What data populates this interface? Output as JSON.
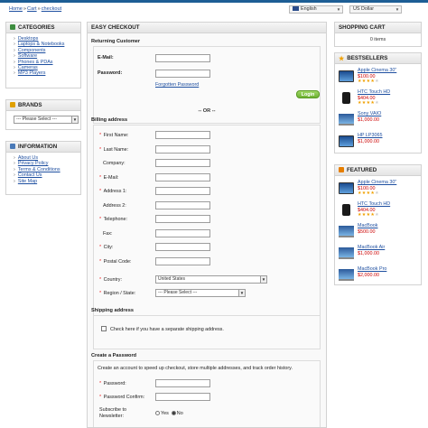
{
  "breadcrumb": {
    "items": [
      "Home",
      "Cart",
      "checkout"
    ]
  },
  "header": {
    "language": "English",
    "currency": "US Dollar"
  },
  "sidebar_left": {
    "categories": {
      "title": "CATEGORIES",
      "items": [
        "Desktops",
        "Laptops & Notebooks",
        "Components",
        "Software",
        "Phones & PDAs",
        "Cameras",
        "MP3 Players"
      ]
    },
    "brands": {
      "title": "BRANDS",
      "select": "--- Please Select ---"
    },
    "information": {
      "title": "INFORMATION",
      "items": [
        "About Us",
        "Privacy Policy",
        "Terms & Conditions",
        "Contact Us",
        "Site Map"
      ]
    }
  },
  "checkout": {
    "title": "EASY CHECKOUT",
    "returning": {
      "title": "Returning Customer",
      "email_label": "E-Mail:",
      "password_label": "Password:",
      "forgotten": "Forgotten Password",
      "login": "Login"
    },
    "or": "-- OR --",
    "billing": {
      "title": "Billing address",
      "fields": [
        {
          "label": "First Name:",
          "req": true
        },
        {
          "label": "Last Name:",
          "req": true
        },
        {
          "label": "Company:",
          "req": false
        },
        {
          "label": "E-Mail:",
          "req": true
        },
        {
          "label": "Address 1:",
          "req": true
        },
        {
          "label": "Address 2:",
          "req": false
        },
        {
          "label": "Telephone:",
          "req": true
        },
        {
          "label": "Fax:",
          "req": false
        },
        {
          "label": "City:",
          "req": true
        },
        {
          "label": "Postal Code:",
          "req": true
        }
      ],
      "country_label": "Country:",
      "country_value": "United States",
      "region_label": "Region / State:",
      "region_value": "--- Please Select ---"
    },
    "shipping": {
      "title": "Shipping address",
      "checkbox_label": "Check here if you have a separate shipping address."
    },
    "create_password": {
      "title": "Create a Password",
      "intro": "Create an account to speed up checkout, store multiple addresses, and track order history.",
      "password_label": "Password:",
      "confirm_label": "Password Confirm:",
      "subscribe_label_1": "Subscribe to",
      "subscribe_label_2": "Newsletter:",
      "yes": "Yes",
      "no": "No",
      "subscribe_selected": "No"
    }
  },
  "sidebar_right": {
    "cart": {
      "title": "SHOPPING CART",
      "count": "0 items"
    },
    "bestsellers": {
      "title": "BESTSELLERS",
      "items": [
        {
          "name": "Apple Cinema 30\"",
          "price": "$100.00",
          "rating": 4,
          "thumb": "monitor"
        },
        {
          "name": "HTC Touch HD",
          "price": "$404.00",
          "rating": 4,
          "thumb": "phone"
        },
        {
          "name": "Sony VAIO",
          "price": "$1,000.00",
          "rating": 0,
          "thumb": "laptop"
        },
        {
          "name": "HP LP3065",
          "price": "$1,000.00",
          "rating": 0,
          "thumb": "monitor"
        }
      ]
    },
    "featured": {
      "title": "FEATURED",
      "items": [
        {
          "name": "Apple Cinema 30\"",
          "price": "$100.00",
          "rating": 4,
          "thumb": "monitor"
        },
        {
          "name": "HTC Touch HD",
          "price": "$404.00",
          "rating": 4,
          "thumb": "phone"
        },
        {
          "name": "MacBook",
          "price": "$500.00",
          "rating": 0,
          "thumb": "laptop"
        },
        {
          "name": "MacBook Air",
          "price": "$1,000.00",
          "rating": 0,
          "thumb": "laptop"
        },
        {
          "name": "MacBook Pro",
          "price": "$2,000.00",
          "rating": 0,
          "thumb": "laptop"
        }
      ]
    }
  }
}
